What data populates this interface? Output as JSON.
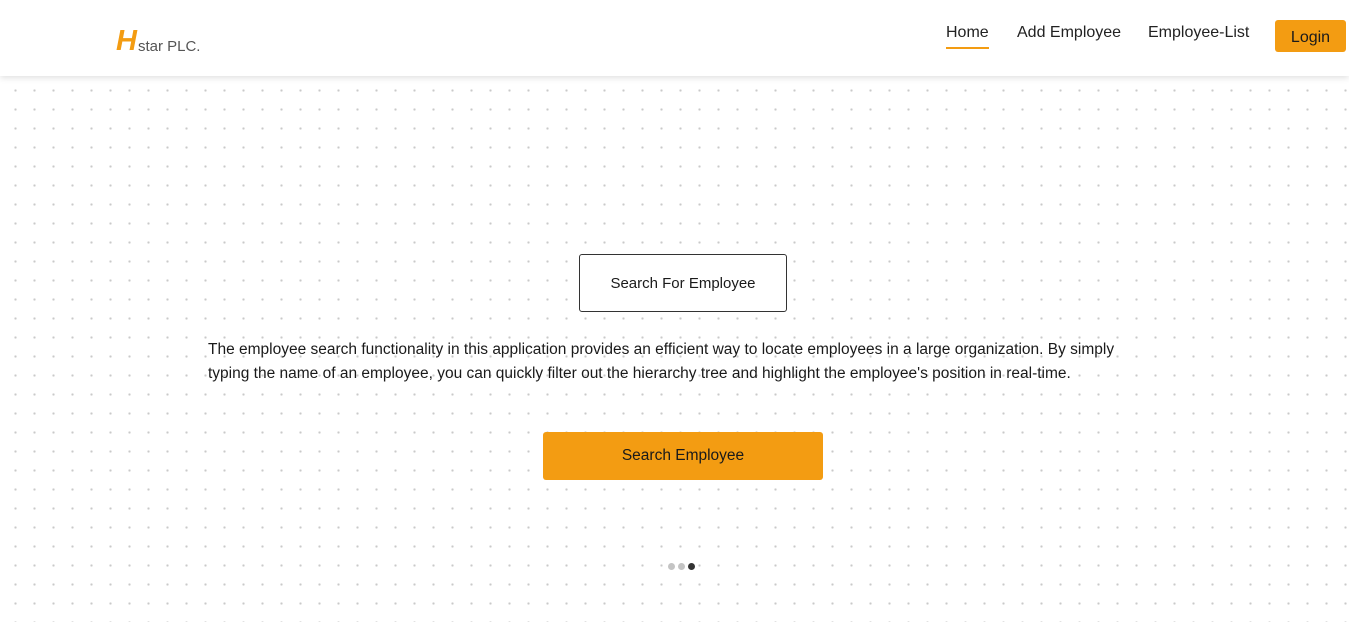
{
  "brand": {
    "initial": "H",
    "name": "star PLC."
  },
  "nav": {
    "home": "Home",
    "add_employee": "Add Employee",
    "employee_list": "Employee-List",
    "login": "Login",
    "active": "Home"
  },
  "hero": {
    "heading": "Search For Employee",
    "description": "The employee search functionality in this application provides an efficient way to locate employees in a large organization. By simply typing the name of an employee, you can quickly filter out the hierarchy tree and highlight the employee's position in real-time.",
    "cta": "Search Employee"
  },
  "carousel": {
    "total_slides": 3,
    "active_slide": 3
  },
  "colors": {
    "accent": "#f39c12",
    "text": "#1a1a1a",
    "dot_inactive": "#c4c4c4",
    "dot_active": "#333333"
  }
}
